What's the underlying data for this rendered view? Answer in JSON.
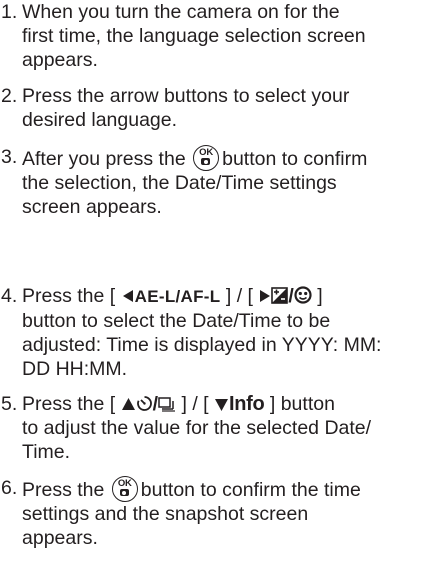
{
  "steps": [
    {
      "num": "1.",
      "lines": [
        "When you turn the camera on for the",
        "first time, the language selection screen",
        "appears."
      ]
    },
    {
      "num": "2.",
      "lines": [
        "Press the arrow buttons to select your",
        "desired language."
      ]
    },
    {
      "num": "3.",
      "l1_pre": "After you press the",
      "l1_post": "button to confirm",
      "l2": "the selection, the Date/Time settings",
      "l3": "screen appears."
    },
    {
      "num": "4.",
      "l1_pre": "Press the [",
      "l1_ael": "AE-L/AF-L",
      "l1_mid": "] / [",
      "l1_post": "]",
      "l2": "button to select the Date/Time to be",
      "l3": "adjusted: Time is displayed in YYYY: MM:",
      "l4": "DD HH:MM."
    },
    {
      "num": "5.",
      "l1_pre": "Press the [",
      "l1_mid": "] / [",
      "l1_info": "Info",
      "l1_post": "] button",
      "l2": "to adjust the value for the selected Date/",
      "l3": "Time."
    },
    {
      "num": "6.",
      "l1_pre": "Press the",
      "l1_post": "button to confirm the time",
      "l2": "settings and the snapshot screen",
      "l3": "appears."
    }
  ],
  "ok_button": {
    "top": "OK"
  },
  "icons": {
    "left": "left-arrow-icon",
    "play": "play-icon",
    "exposure": "exposure-compensation-icon",
    "face": "face-detection-icon",
    "up": "up-arrow-icon",
    "self_timer": "self-timer-icon",
    "drive": "continuous-shooting-icon",
    "down": "down-arrow-icon",
    "ok_camera": "camera-icon"
  }
}
